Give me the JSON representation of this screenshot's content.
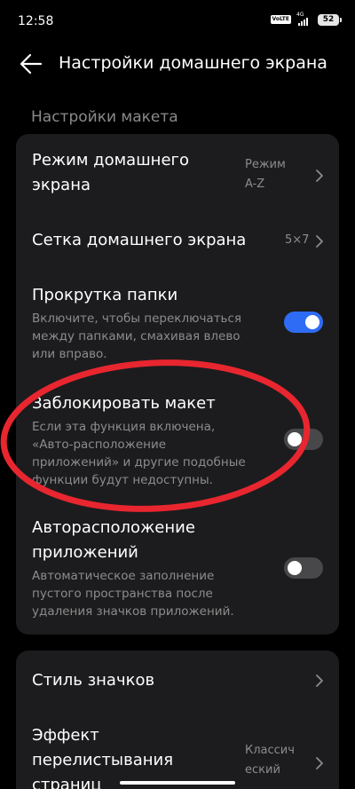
{
  "status_bar": {
    "time": "12:58",
    "volte": "VoLTE",
    "network": "4G",
    "battery": "52"
  },
  "header": {
    "title": "Настройки домашнего экрана"
  },
  "section_label": "Настройки макета",
  "settings": [
    {
      "title_line1": "Режим домашнего",
      "title_line2": "экрана",
      "value_line1": "Режим",
      "value_line2": "A-Z"
    },
    {
      "title": "Сетка домашнего экрана",
      "value": "5×7"
    },
    {
      "title": "Прокрутка папки",
      "desc_line1": "Включите, чтобы переключаться",
      "desc_line2": "между папками, смахивая влево",
      "desc_line3": "или вправо.",
      "toggle": "on"
    },
    {
      "title": "Заблокировать макет",
      "desc_line1": "Если эта функция включена,",
      "desc_line2": "«Авто-расположение",
      "desc_line3": "приложений» и другие подобные",
      "desc_line4": "функции будут недоступны.",
      "toggle": "off"
    },
    {
      "title_line1": "Авторасположение",
      "title_line2": "приложений",
      "desc_line1": "Автоматическое заполнение",
      "desc_line2": "пустого пространства после",
      "desc_line3": "удаления значков приложений.",
      "toggle": "off"
    }
  ],
  "settings2": [
    {
      "title": "Стиль значков"
    },
    {
      "title_line1": "Эффект",
      "title_line2": "перелистывания",
      "title_line3": "страниц",
      "value_line1": "Классич",
      "value_line2": "еский"
    }
  ],
  "colors": {
    "accent": "#2f6cf6",
    "annotation": "#e8262f",
    "card": "#1c1c1e"
  }
}
